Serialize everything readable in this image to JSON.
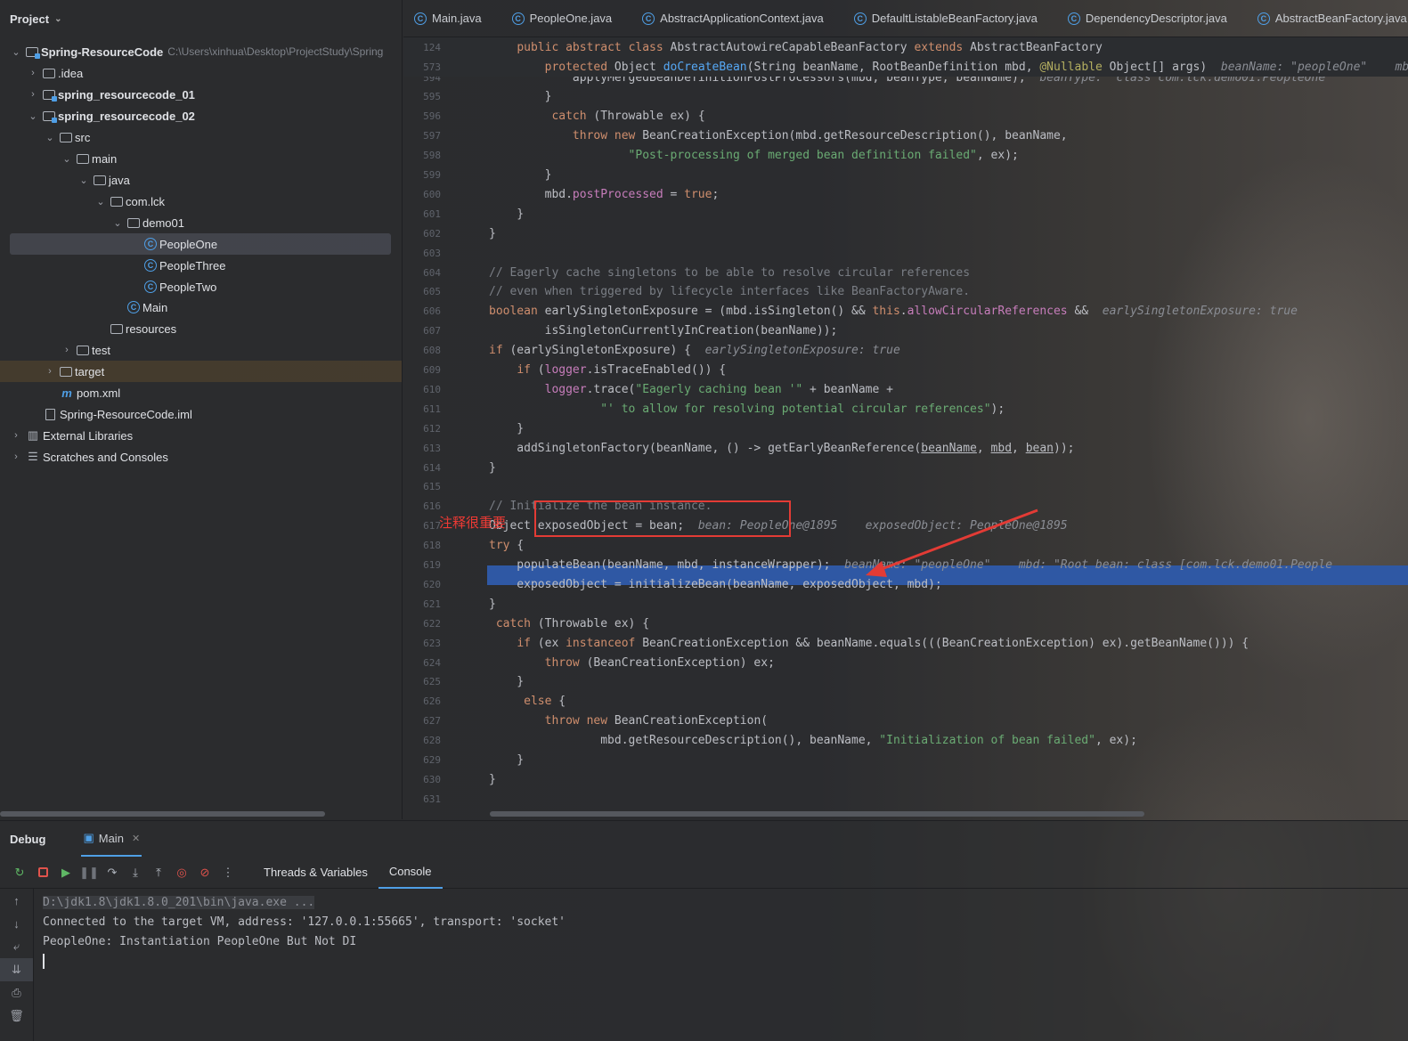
{
  "project": {
    "title": "Project",
    "items": [
      {
        "label": "Spring-ResourceCode",
        "path": "C:\\Users\\xinhua\\Desktop\\ProjectStudy\\Spring",
        "bold": true
      },
      {
        "label": ".idea"
      },
      {
        "label": "spring_resourcecode_01",
        "bold": true
      },
      {
        "label": "spring_resourcecode_02",
        "bold": true
      },
      {
        "label": "src"
      },
      {
        "label": "main"
      },
      {
        "label": "java"
      },
      {
        "label": "com.lck"
      },
      {
        "label": "demo01"
      },
      {
        "label": "PeopleOne"
      },
      {
        "label": "PeopleThree"
      },
      {
        "label": "PeopleTwo"
      },
      {
        "label": "Main"
      },
      {
        "label": "resources"
      },
      {
        "label": "test"
      },
      {
        "label": "target"
      },
      {
        "label": "pom.xml"
      },
      {
        "label": "Spring-ResourceCode.iml"
      },
      {
        "label": "External Libraries"
      },
      {
        "label": "Scratches and Consoles"
      }
    ]
  },
  "tabs": [
    "Main.java",
    "PeopleOne.java",
    "AbstractApplicationContext.java",
    "DefaultListableBeanFactory.java",
    "DependencyDescriptor.java",
    "AbstractBeanFactory.java"
  ],
  "editor": {
    "sticky": [
      {
        "num": "124",
        "code": "    public abstract class AbstractAutowireCapableBeanFactory extends AbstractBeanFactory"
      },
      {
        "num": "573",
        "code": "        protected Object doCreateBean(String beanName, RootBeanDefinition mbd, @Nullable Object[] args)",
        "hint": "beanName: \"peopleOne\"    mbd"
      }
    ],
    "lines": [
      {
        "num": "594",
        "code": "            applyMergedBeanDefinitionPostProcessors(mbd, beanType, beanName);",
        "hint": "beanType: \"class com.lck.demo01.PeopleOne"
      },
      {
        "num": "595",
        "code": "        }"
      },
      {
        "num": "596",
        "code": "         catch (Throwable ex) {"
      },
      {
        "num": "597",
        "code": "            throw new BeanCreationException(mbd.getResourceDescription(), beanName,"
      },
      {
        "num": "598",
        "code": "                    \"Post-processing of merged bean definition failed\", ex);"
      },
      {
        "num": "599",
        "code": "        }"
      },
      {
        "num": "600",
        "code": "        mbd.postProcessed = true;"
      },
      {
        "num": "601",
        "code": "    }"
      },
      {
        "num": "602",
        "code": "}"
      },
      {
        "num": "603",
        "code": ""
      },
      {
        "num": "604",
        "code": "// Eagerly cache singletons to be able to resolve circular references"
      },
      {
        "num": "605",
        "code": "// even when triggered by lifecycle interfaces like BeanFactoryAware."
      },
      {
        "num": "606",
        "code": "boolean earlySingletonExposure = (mbd.isSingleton() && this.allowCircularReferences &&",
        "hint": "earlySingletonExposure: true"
      },
      {
        "num": "607",
        "code": "        isSingletonCurrentlyInCreation(beanName));"
      },
      {
        "num": "608",
        "code": "if (earlySingletonExposure) {",
        "hint": "earlySingletonExposure: true"
      },
      {
        "num": "609",
        "code": "    if (logger.isTraceEnabled()) {"
      },
      {
        "num": "610",
        "code": "        logger.trace(\"Eagerly caching bean '\" + beanName +"
      },
      {
        "num": "611",
        "code": "                \"' to allow for resolving potential circular references\");"
      },
      {
        "num": "612",
        "code": "    }"
      },
      {
        "num": "613",
        "code": "    addSingletonFactory(beanName, () -> getEarlyBeanReference(beanName, mbd, bean));"
      },
      {
        "num": "614",
        "code": "}"
      },
      {
        "num": "615",
        "code": ""
      },
      {
        "num": "616",
        "code": "// Initialize the bean instance."
      },
      {
        "num": "617",
        "code": "Object exposedObject = bean;",
        "hint": "bean: PeopleOne@1895    exposedObject: PeopleOne@1895"
      },
      {
        "num": "618",
        "code": "try {"
      },
      {
        "num": "619",
        "code": "    populateBean(beanName, mbd, instanceWrapper);",
        "hint": "beanName: \"peopleOne\"    mbd: \"Root bean: class [com.lck.demo01.People"
      },
      {
        "num": "620",
        "code": "    exposedObject = initializeBean(beanName, exposedObject, mbd);"
      },
      {
        "num": "621",
        "code": "}"
      },
      {
        "num": "622",
        "code": " catch (Throwable ex) {"
      },
      {
        "num": "623",
        "code": "    if (ex instanceof BeanCreationException && beanName.equals(((BeanCreationException) ex).getBeanName())) {"
      },
      {
        "num": "624",
        "code": "        throw (BeanCreationException) ex;"
      },
      {
        "num": "625",
        "code": "    }"
      },
      {
        "num": "626",
        "code": "     else {"
      },
      {
        "num": "627",
        "code": "        throw new BeanCreationException("
      },
      {
        "num": "628",
        "code": "                mbd.getResourceDescription(), beanName, \"Initialization of bean failed\", ex);"
      },
      {
        "num": "629",
        "code": "    }"
      },
      {
        "num": "630",
        "code": "}"
      },
      {
        "num": "631",
        "code": ""
      }
    ],
    "annotation": "注释很重要"
  },
  "debug": {
    "title": "Debug",
    "session": "Main",
    "tabs": [
      "Threads & Variables",
      "Console"
    ],
    "console": [
      "D:\\jdk1.8\\jdk1.8.0_201\\bin\\java.exe ...",
      "Connected to the target VM, address: '127.0.0.1:55665', transport: 'socket'",
      "PeopleOne: Instantiation PeopleOne But Not DI"
    ]
  },
  "colors": {
    "accent": "#4f9fe6",
    "highlight": "#2f58a4",
    "annotation": "#e33b35"
  }
}
